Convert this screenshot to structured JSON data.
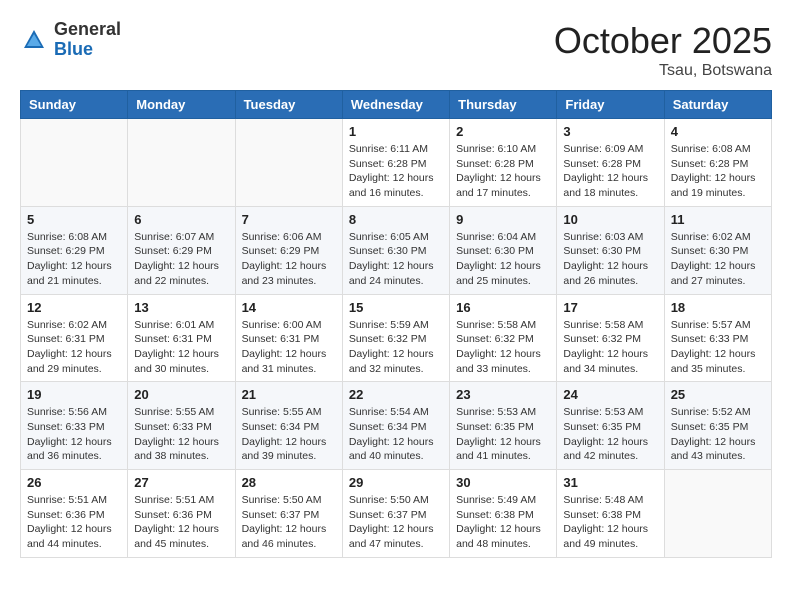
{
  "header": {
    "logo_general": "General",
    "logo_blue": "Blue",
    "month_title": "October 2025",
    "location": "Tsau, Botswana"
  },
  "weekdays": [
    "Sunday",
    "Monday",
    "Tuesday",
    "Wednesday",
    "Thursday",
    "Friday",
    "Saturday"
  ],
  "weeks": [
    [
      {
        "day": "",
        "info": ""
      },
      {
        "day": "",
        "info": ""
      },
      {
        "day": "",
        "info": ""
      },
      {
        "day": "1",
        "info": "Sunrise: 6:11 AM\nSunset: 6:28 PM\nDaylight: 12 hours\nand 16 minutes."
      },
      {
        "day": "2",
        "info": "Sunrise: 6:10 AM\nSunset: 6:28 PM\nDaylight: 12 hours\nand 17 minutes."
      },
      {
        "day": "3",
        "info": "Sunrise: 6:09 AM\nSunset: 6:28 PM\nDaylight: 12 hours\nand 18 minutes."
      },
      {
        "day": "4",
        "info": "Sunrise: 6:08 AM\nSunset: 6:28 PM\nDaylight: 12 hours\nand 19 minutes."
      }
    ],
    [
      {
        "day": "5",
        "info": "Sunrise: 6:08 AM\nSunset: 6:29 PM\nDaylight: 12 hours\nand 21 minutes."
      },
      {
        "day": "6",
        "info": "Sunrise: 6:07 AM\nSunset: 6:29 PM\nDaylight: 12 hours\nand 22 minutes."
      },
      {
        "day": "7",
        "info": "Sunrise: 6:06 AM\nSunset: 6:29 PM\nDaylight: 12 hours\nand 23 minutes."
      },
      {
        "day": "8",
        "info": "Sunrise: 6:05 AM\nSunset: 6:30 PM\nDaylight: 12 hours\nand 24 minutes."
      },
      {
        "day": "9",
        "info": "Sunrise: 6:04 AM\nSunset: 6:30 PM\nDaylight: 12 hours\nand 25 minutes."
      },
      {
        "day": "10",
        "info": "Sunrise: 6:03 AM\nSunset: 6:30 PM\nDaylight: 12 hours\nand 26 minutes."
      },
      {
        "day": "11",
        "info": "Sunrise: 6:02 AM\nSunset: 6:30 PM\nDaylight: 12 hours\nand 27 minutes."
      }
    ],
    [
      {
        "day": "12",
        "info": "Sunrise: 6:02 AM\nSunset: 6:31 PM\nDaylight: 12 hours\nand 29 minutes."
      },
      {
        "day": "13",
        "info": "Sunrise: 6:01 AM\nSunset: 6:31 PM\nDaylight: 12 hours\nand 30 minutes."
      },
      {
        "day": "14",
        "info": "Sunrise: 6:00 AM\nSunset: 6:31 PM\nDaylight: 12 hours\nand 31 minutes."
      },
      {
        "day": "15",
        "info": "Sunrise: 5:59 AM\nSunset: 6:32 PM\nDaylight: 12 hours\nand 32 minutes."
      },
      {
        "day": "16",
        "info": "Sunrise: 5:58 AM\nSunset: 6:32 PM\nDaylight: 12 hours\nand 33 minutes."
      },
      {
        "day": "17",
        "info": "Sunrise: 5:58 AM\nSunset: 6:32 PM\nDaylight: 12 hours\nand 34 minutes."
      },
      {
        "day": "18",
        "info": "Sunrise: 5:57 AM\nSunset: 6:33 PM\nDaylight: 12 hours\nand 35 minutes."
      }
    ],
    [
      {
        "day": "19",
        "info": "Sunrise: 5:56 AM\nSunset: 6:33 PM\nDaylight: 12 hours\nand 36 minutes."
      },
      {
        "day": "20",
        "info": "Sunrise: 5:55 AM\nSunset: 6:33 PM\nDaylight: 12 hours\nand 38 minutes."
      },
      {
        "day": "21",
        "info": "Sunrise: 5:55 AM\nSunset: 6:34 PM\nDaylight: 12 hours\nand 39 minutes."
      },
      {
        "day": "22",
        "info": "Sunrise: 5:54 AM\nSunset: 6:34 PM\nDaylight: 12 hours\nand 40 minutes."
      },
      {
        "day": "23",
        "info": "Sunrise: 5:53 AM\nSunset: 6:35 PM\nDaylight: 12 hours\nand 41 minutes."
      },
      {
        "day": "24",
        "info": "Sunrise: 5:53 AM\nSunset: 6:35 PM\nDaylight: 12 hours\nand 42 minutes."
      },
      {
        "day": "25",
        "info": "Sunrise: 5:52 AM\nSunset: 6:35 PM\nDaylight: 12 hours\nand 43 minutes."
      }
    ],
    [
      {
        "day": "26",
        "info": "Sunrise: 5:51 AM\nSunset: 6:36 PM\nDaylight: 12 hours\nand 44 minutes."
      },
      {
        "day": "27",
        "info": "Sunrise: 5:51 AM\nSunset: 6:36 PM\nDaylight: 12 hours\nand 45 minutes."
      },
      {
        "day": "28",
        "info": "Sunrise: 5:50 AM\nSunset: 6:37 PM\nDaylight: 12 hours\nand 46 minutes."
      },
      {
        "day": "29",
        "info": "Sunrise: 5:50 AM\nSunset: 6:37 PM\nDaylight: 12 hours\nand 47 minutes."
      },
      {
        "day": "30",
        "info": "Sunrise: 5:49 AM\nSunset: 6:38 PM\nDaylight: 12 hours\nand 48 minutes."
      },
      {
        "day": "31",
        "info": "Sunrise: 5:48 AM\nSunset: 6:38 PM\nDaylight: 12 hours\nand 49 minutes."
      },
      {
        "day": "",
        "info": ""
      }
    ]
  ]
}
